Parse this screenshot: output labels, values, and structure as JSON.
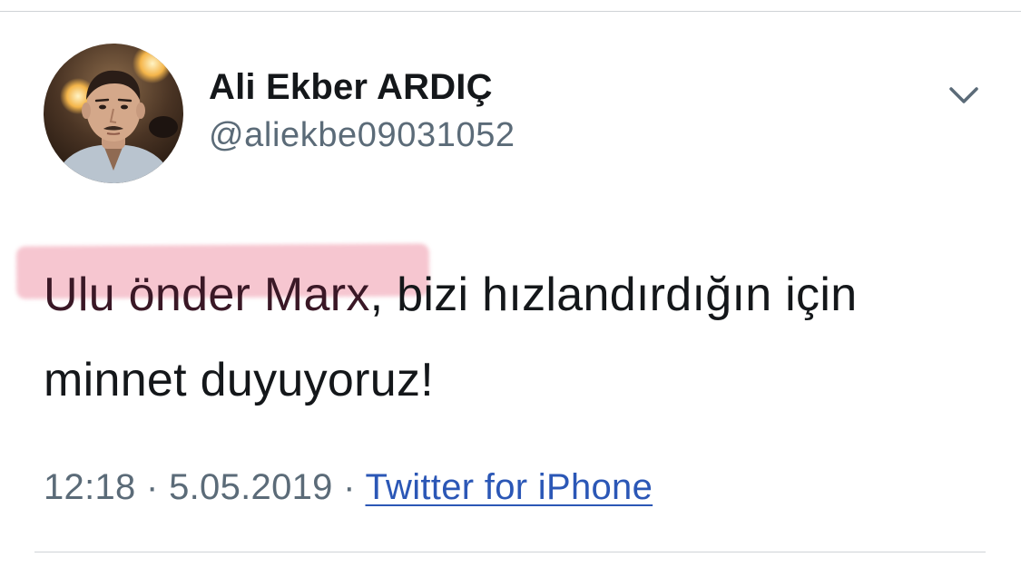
{
  "author": {
    "name": "Ali Ekber ARDIÇ",
    "handle": "@aliekbe09031052"
  },
  "tweet": {
    "highlighted_text": "Ulu önder Marx",
    "rest_text": ", bizi hızlandırdığın için minnet duyuyoruz!",
    "highlight_color": "#ea8096"
  },
  "meta": {
    "time": "12:18",
    "separator": "·",
    "date": "5.05.2019",
    "source": "Twitter for iPhone"
  },
  "icons": {
    "menu": "chevron-down-icon"
  },
  "colors": {
    "text": "#14171a",
    "secondary": "#5b6b78",
    "link": "#2b57b6",
    "divider": "#cfd3d6"
  }
}
